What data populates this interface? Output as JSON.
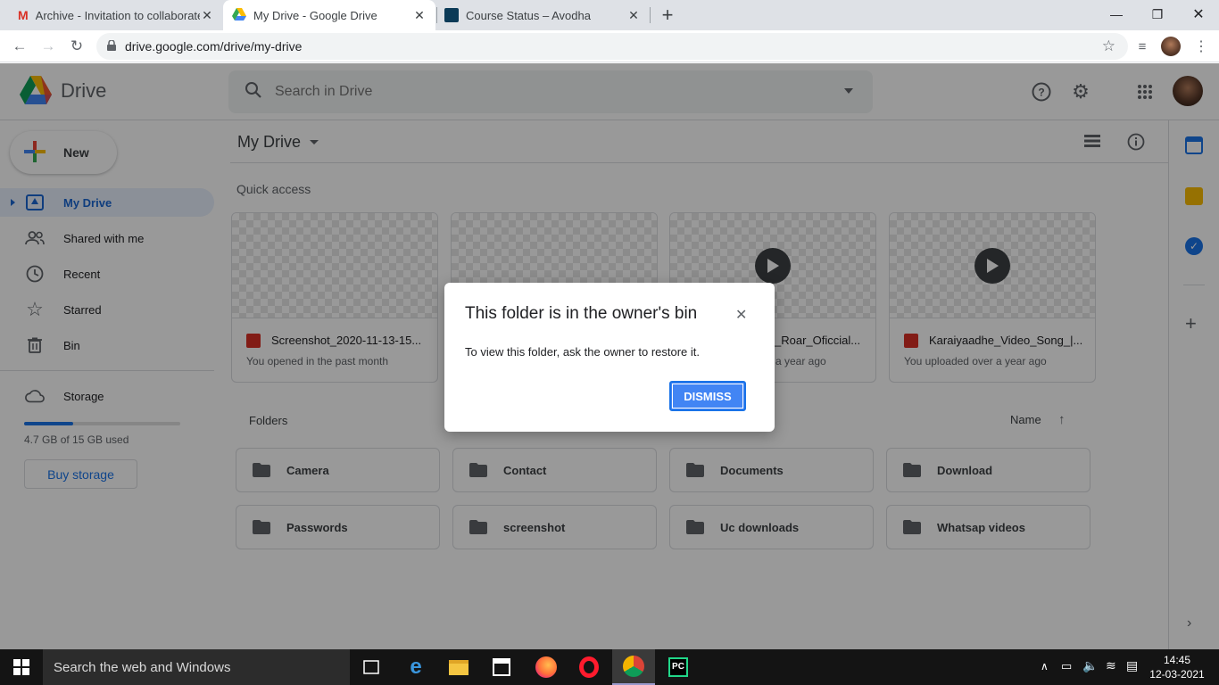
{
  "browser": {
    "tabs": [
      {
        "title": "Archive - Invitation to collaborate",
        "favicon": "gmail-icon"
      },
      {
        "title": "My Drive - Google Drive",
        "favicon": "drive-icon",
        "active": true
      },
      {
        "title": "Course Status – Avodha",
        "favicon": "avodha-icon"
      }
    ],
    "url": "drive.google.com/drive/my-drive"
  },
  "drive": {
    "product_name": "Drive",
    "search_placeholder": "Search in Drive",
    "new_label": "New",
    "nav": [
      {
        "label": "My Drive",
        "icon": "my-drive-icon",
        "active": true
      },
      {
        "label": "Shared with me",
        "icon": "shared-icon"
      },
      {
        "label": "Recent",
        "icon": "clock-icon"
      },
      {
        "label": "Starred",
        "icon": "star-icon"
      },
      {
        "label": "Bin",
        "icon": "bin-icon"
      }
    ],
    "storage": {
      "label": "Storage",
      "used_text": "4.7 GB of 15 GB used",
      "used_fraction": 0.313,
      "buy_label": "Buy storage"
    },
    "page_title": "My Drive",
    "quick_access_label": "Quick access",
    "quick_access": [
      {
        "name": "Screenshot_2020-11-13-15...",
        "sub": "You opened in the past month",
        "type": "image",
        "play": false
      },
      {
        "name": "",
        "sub": "",
        "type": "unknown",
        "play": false
      },
      {
        "name": "_Roar_Oficcial...",
        "sub": "a year ago",
        "type": "video",
        "play": true
      },
      {
        "name": "Karaiyaadhe_Video_Song_|...",
        "sub": "You uploaded over a year ago",
        "type": "video",
        "play": true
      }
    ],
    "folders_label": "Folders",
    "sort_label": "Name",
    "folders": [
      "Camera",
      "Contact",
      "Documents",
      "Download",
      "Passwords",
      "screenshot",
      "Uc downloads",
      "Whatsap videos"
    ]
  },
  "dialog": {
    "title": "This folder is in the owner's bin",
    "body": "To view this folder, ask the owner to restore it.",
    "dismiss_label": "DISMISS"
  },
  "taskbar": {
    "search_text": "Search the web and Windows",
    "time": "14:45",
    "date": "12-03-2021"
  },
  "colors": {
    "accent": "#1a73e8",
    "dismiss": "#4285f4",
    "active_nav_bg": "#e8f0fe"
  }
}
